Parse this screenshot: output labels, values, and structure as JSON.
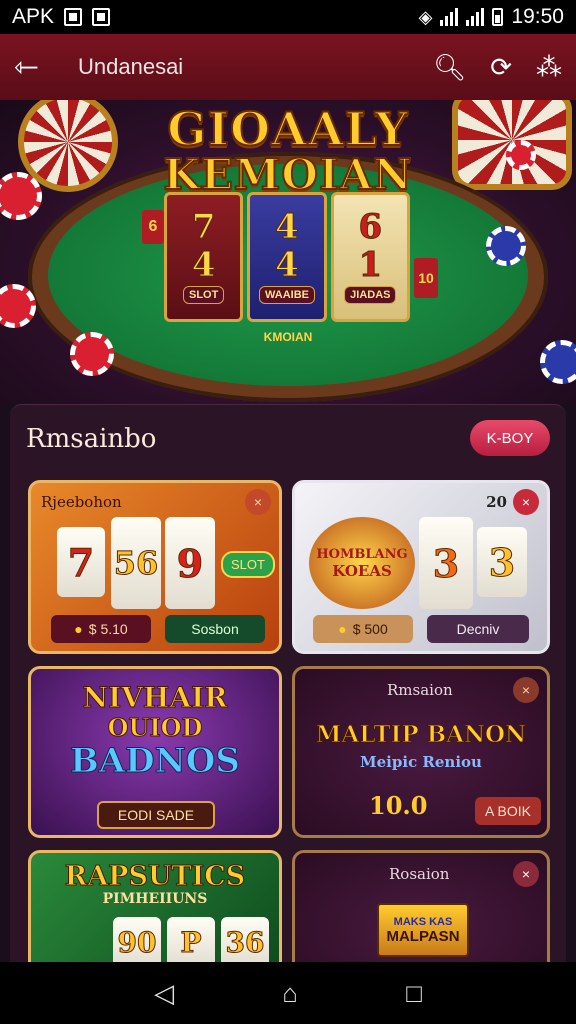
{
  "status_bar": {
    "left_label": "APK",
    "time": "19:50",
    "icons": [
      "gallery-icon",
      "image-icon",
      "wifi-icon",
      "signal-icon",
      "battery-icon"
    ]
  },
  "app_bar": {
    "title": "Undanesai",
    "back_icon": "arrow-left-icon",
    "actions": [
      "search-icon",
      "refresh-icon",
      "paw-icon"
    ]
  },
  "hero": {
    "title_line1": "GIOAALY",
    "title_line2": "KEMOIAN",
    "reels": [
      {
        "top": "7",
        "mid": "4",
        "tag": "SLOT"
      },
      {
        "top": "4",
        "mid": "4",
        "tag": "WAAIBE"
      },
      {
        "top": "6",
        "mid": "1",
        "tag": "JIADAS"
      }
    ],
    "left_card": "6",
    "right_card": "10",
    "felt_label": "KMOIAN"
  },
  "section": {
    "title": "Rmsainbo",
    "play_button": "K-BOY"
  },
  "cards": {
    "c1": {
      "title": "Rjeebohon",
      "close": "×",
      "tiles": [
        "7",
        "56",
        "9"
      ],
      "slot_badge": "SLOT",
      "pill_left": "$ 5.10",
      "pill_right": "Sosbon"
    },
    "c2": {
      "title": "20",
      "close": "×",
      "logo_line1": "HOMBLANG",
      "logo_line2": "KOEAS",
      "tiles": [
        "3",
        "3"
      ],
      "pill_left": "$ 500",
      "pill_right": "Decniv"
    },
    "c3": {
      "line1": "NIVHAIR",
      "line2": "OUIOD",
      "line3": "BADNOS",
      "button": "EODI SADE"
    },
    "c4": {
      "title": "Rmsaion",
      "close": "×",
      "big": "MALTIP BANON",
      "sub": "Meipic Reniou",
      "amount": "10.0",
      "button": "A BOIK"
    },
    "c5": {
      "line1": "RAPSUTICS",
      "line2": "PIMHEIIUNS",
      "tiles": [
        "90",
        "P",
        "36"
      ]
    },
    "c6": {
      "title": "Rosaion",
      "close": "×",
      "logo_line1": "MAKS KAS",
      "logo_line2": "MALPASN"
    }
  },
  "nav_bar": [
    "back-triangle-icon",
    "home-icon",
    "recents-square-icon"
  ],
  "colors": {
    "app_bar": "#6a1020",
    "panel": "#2b1426",
    "accent_pink": "#d8304f",
    "gold": "#ffcc2e"
  }
}
